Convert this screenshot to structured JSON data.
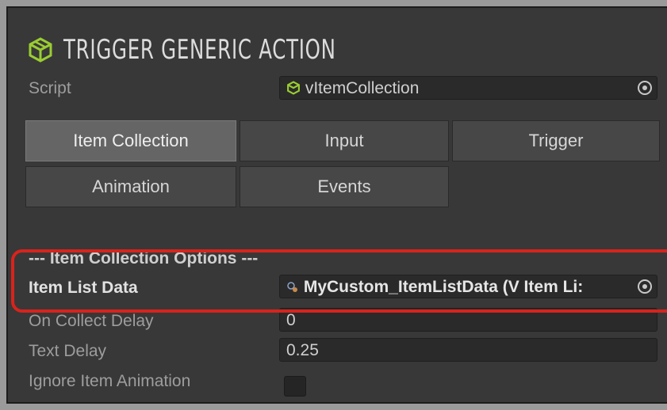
{
  "header": {
    "title": "TRIGGER GENERIC ACTION",
    "icon": "cube-icon"
  },
  "script_row": {
    "label": "Script",
    "value": "vItemCollection"
  },
  "tabs": [
    {
      "label": "Item Collection",
      "active": true
    },
    {
      "label": "Input",
      "active": false
    },
    {
      "label": "Trigger",
      "active": false
    },
    {
      "label": "Animation",
      "active": false
    },
    {
      "label": "Events",
      "active": false
    }
  ],
  "section": {
    "title": "--- Item Collection Options ---",
    "item_list_data": {
      "label": "Item List Data",
      "value": "MyCustom_ItemListData (V Item Li:"
    },
    "on_collect_delay": {
      "label": "On Collect Delay",
      "value": "0"
    },
    "text_delay": {
      "label": "Text Delay",
      "value": "0.25"
    },
    "ignore_item_animation": {
      "label": "Ignore Item Animation",
      "checked": false
    }
  },
  "colors": {
    "accent_green": "#9acd32",
    "highlight_red": "#d8231c"
  }
}
